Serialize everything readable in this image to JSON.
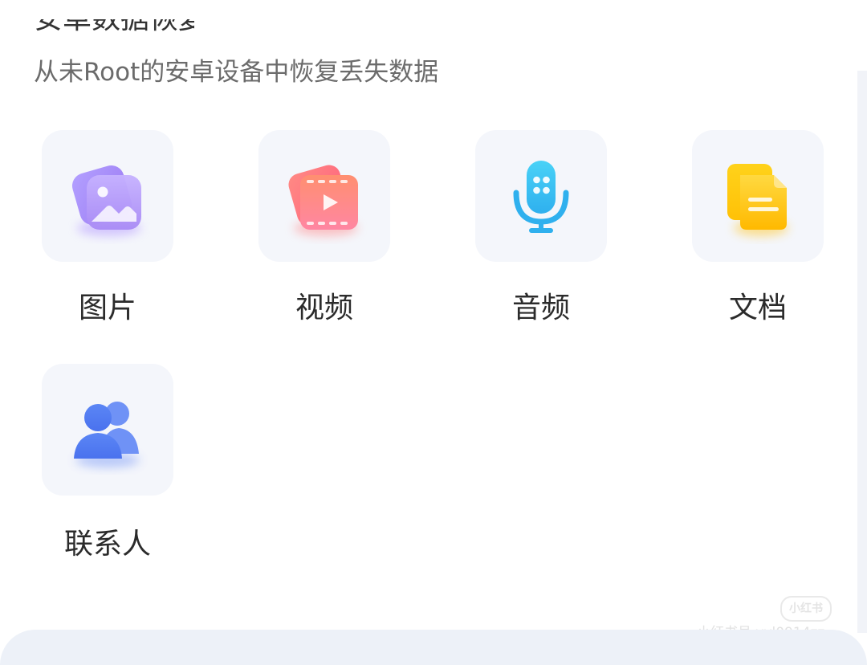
{
  "header": {
    "title_clipped": "安卓数据恢复",
    "subtitle": "从未Root的安卓设备中恢复丢失数据"
  },
  "categories": [
    {
      "label": "图片",
      "icon": "picture-icon",
      "color": "#a98bf5"
    },
    {
      "label": "视频",
      "icon": "video-icon",
      "color": "#ff7f86"
    },
    {
      "label": "音频",
      "icon": "microphone-icon",
      "color": "#2fb6f0"
    },
    {
      "label": "文档",
      "icon": "document-icon",
      "color": "#ffbf0d"
    },
    {
      "label": "联系人",
      "icon": "contacts-icon",
      "color": "#4f79ef"
    }
  ],
  "watermark": {
    "badge": "小红书",
    "text": "小红书号 yyl0914zz"
  }
}
